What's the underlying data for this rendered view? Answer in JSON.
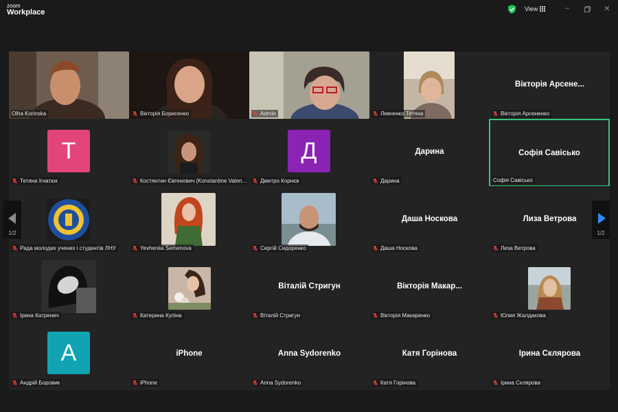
{
  "app": {
    "brand_small": "zoom",
    "brand_big": "Workplace",
    "view_label": "View"
  },
  "colors": {
    "active_border": "#3ac27d",
    "avatar_pink": "#e2447b",
    "avatar_purple": "#8b23b4",
    "avatar_teal": "#11a3b2",
    "nav_arrow_right": "#2d8cff",
    "mic_muted": "#e0403a"
  },
  "pager": {
    "left": "1/2",
    "right": "1/2"
  },
  "tiles": [
    {
      "name": "Olha Korinska",
      "big": ""
    },
    {
      "name": "Вікторія Борисенко",
      "big": ""
    },
    {
      "name": "Admin",
      "big": ""
    },
    {
      "name": "Левченко Тетяна",
      "big": ""
    },
    {
      "name": "Вікторія Арсененко",
      "big": "Вікторія Арсене..."
    },
    {
      "name": "Тетяна Ігнатюк",
      "big": "",
      "avatar": "Т"
    },
    {
      "name": "Костянтин Євгенович (Konstantine Valen...",
      "big": ""
    },
    {
      "name": "Дмитро Корнєв",
      "big": "",
      "avatar": "Д"
    },
    {
      "name": "Дарина",
      "big": "Дарина"
    },
    {
      "name": "Софія Савісько",
      "big": "Софія Савісько"
    },
    {
      "name": "Рада молодих учених і студентів ЛНУ",
      "big": ""
    },
    {
      "name": "Yevheniia Semenova",
      "big": ""
    },
    {
      "name": "Сергій Сидоренко",
      "big": ""
    },
    {
      "name": "Даша Носкова",
      "big": "Даша Носкова"
    },
    {
      "name": "Лиза Ветрова",
      "big": "Лиза Ветрова"
    },
    {
      "name": "Ірина Катренич",
      "big": ""
    },
    {
      "name": "Катерина Купіна",
      "big": ""
    },
    {
      "name": "Віталій Стригун",
      "big": "Віталій Стригун"
    },
    {
      "name": "Вікторія Макаренко",
      "big": "Вікторія Макар..."
    },
    {
      "name": "Юлия Жалдакова",
      "big": ""
    },
    {
      "name": "Андрій Боровик",
      "big": "",
      "avatar": "А"
    },
    {
      "name": "iPhone",
      "big": "iPhone"
    },
    {
      "name": "Anna Sydorenko",
      "big": "Anna Sydorenko"
    },
    {
      "name": "Катя Горінова",
      "big": "Катя Горінова"
    },
    {
      "name": "Ірина Склярова",
      "big": "Ірина Склярова"
    }
  ]
}
